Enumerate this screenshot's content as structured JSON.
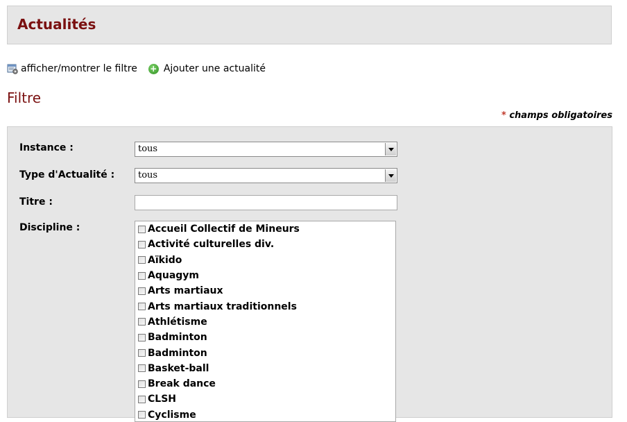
{
  "page": {
    "title": "Actualités"
  },
  "actions": {
    "toggle_filter": {
      "label": "afficher/montrer le filtre",
      "icon": "filter-settings-icon"
    },
    "add_news": {
      "label": "Ajouter une actualité",
      "icon": "add-circle-icon"
    }
  },
  "filter": {
    "title": "Filtre",
    "required_note": {
      "marker": "*",
      "text": "champs obligatoires"
    },
    "fields": {
      "instance": {
        "label": "Instance :",
        "value": "tous"
      },
      "type": {
        "label": "Type d'Actualité :",
        "value": "tous"
      },
      "titre": {
        "label": "Titre :",
        "value": ""
      },
      "discipline": {
        "label": "Discipline :",
        "items": [
          "Accueil Collectif de Mineurs",
          "Activité culturelles div.",
          "Aïkido",
          "Aquagym",
          "Arts martiaux",
          "Arts martiaux traditionnels",
          "Athlétisme",
          "Badminton",
          "Badminton",
          "Basket-ball",
          "Break dance",
          "CLSH",
          "Cyclisme"
        ]
      }
    }
  },
  "colors": {
    "title_red": "#7a1010",
    "panel_gray": "#e6e6e6",
    "add_green": "#2f8f22",
    "required_star": "#c0392b"
  }
}
